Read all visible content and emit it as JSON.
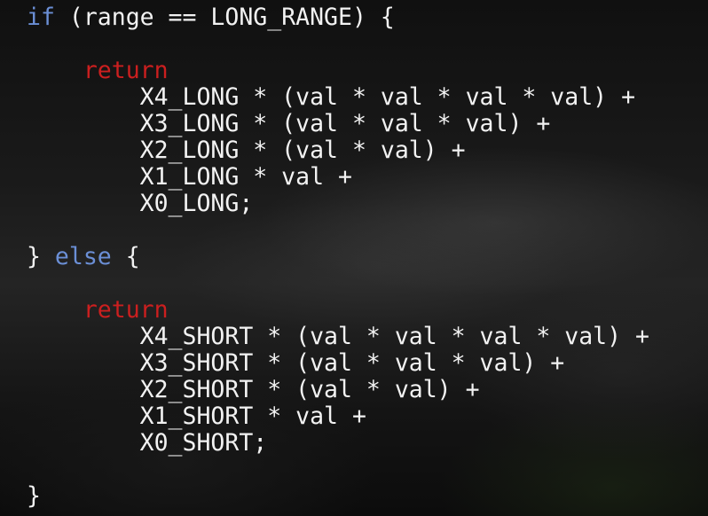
{
  "editor": {
    "theme_colors": {
      "text": "#f2f2f2",
      "keyword_control": "#6b8fd6",
      "keyword_return": "#cc1f1f",
      "background": "#151515"
    },
    "lines": [
      {
        "kw": "if",
        "rest": " (range == LONG_RANGE) {"
      },
      {
        "text": ""
      },
      {
        "indent": "    ",
        "ret": "return"
      },
      {
        "text": "        X4_LONG * (val * val * val * val) +"
      },
      {
        "text": "        X3_LONG * (val * val * val) +"
      },
      {
        "text": "        X2_LONG * (val * val) +"
      },
      {
        "text": "        X1_LONG * val +"
      },
      {
        "text": "        X0_LONG;"
      },
      {
        "text": ""
      },
      {
        "pre": "} ",
        "kw": "else",
        "rest": " {"
      },
      {
        "text": ""
      },
      {
        "indent": "    ",
        "ret": "return"
      },
      {
        "text": "        X4_SHORT * (val * val * val * val) +"
      },
      {
        "text": "        X3_SHORT * (val * val * val) +"
      },
      {
        "text": "        X2_SHORT * (val * val) +"
      },
      {
        "text": "        X1_SHORT * val +"
      },
      {
        "text": "        X0_SHORT;"
      },
      {
        "text": ""
      },
      {
        "text": "}"
      }
    ]
  }
}
